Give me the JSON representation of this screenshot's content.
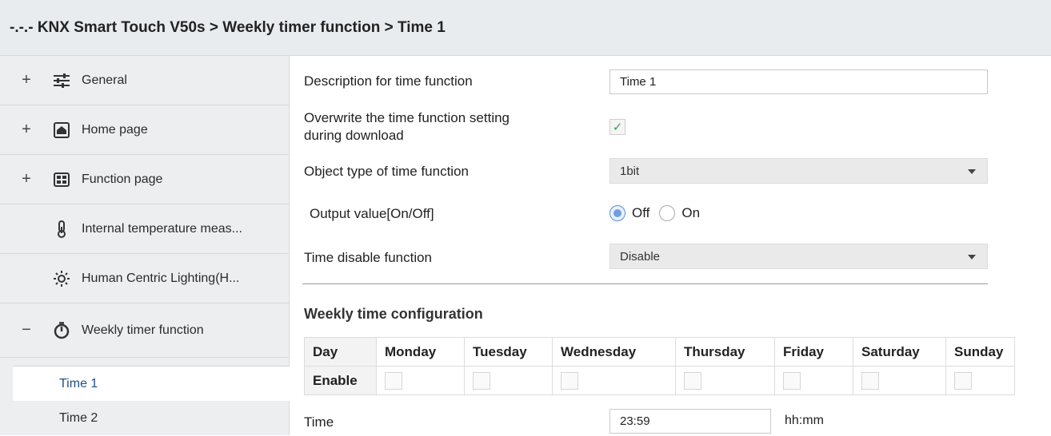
{
  "title": "-.-.- KNX Smart Touch V50s > Weekly timer function > Time 1",
  "sidebar": {
    "items": [
      {
        "expander": "+",
        "icon": "sliders-icon",
        "label": "General"
      },
      {
        "expander": "+",
        "icon": "home-icon",
        "label": "Home page"
      },
      {
        "expander": "+",
        "icon": "grid-icon",
        "label": "Function page"
      },
      {
        "expander": "",
        "icon": "thermometer-icon",
        "label": "Internal temperature meas..."
      },
      {
        "expander": "",
        "icon": "sun-icon",
        "label": "Human Centric Lighting(H..."
      },
      {
        "expander": "−",
        "icon": "timer-icon",
        "label": "Weekly timer function"
      }
    ],
    "sub_items": [
      {
        "label": "Time 1",
        "active": true
      },
      {
        "label": "Time 2",
        "active": false
      }
    ]
  },
  "form": {
    "description_label": "Description for time function",
    "description_value": "Time 1",
    "overwrite_label_1": "Overwrite the time function setting",
    "overwrite_label_2": "during download",
    "overwrite_checked": true,
    "object_type_label": "Object type of time function",
    "object_type_value": "1bit",
    "output_label": "Output value[On/Off]",
    "output_options": [
      "Off",
      "On"
    ],
    "output_selected": "Off",
    "disable_label": "Time disable function",
    "disable_value": "Disable"
  },
  "weekly": {
    "section_title": "Weekly time configuration",
    "row_day": "Day",
    "row_enable": "Enable",
    "days": [
      "Monday",
      "Tuesday",
      "Wednesday",
      "Thursday",
      "Friday",
      "Saturday",
      "Sunday"
    ],
    "enabled": [
      false,
      false,
      false,
      false,
      false,
      false,
      false
    ]
  },
  "time": {
    "label": "Time",
    "value": "23:59",
    "unit": "hh:mm"
  },
  "colors": {
    "active_sub_text": "#1f4f8a",
    "check_green": "#3aa14b",
    "radio_blue": "#6f9fe0"
  }
}
